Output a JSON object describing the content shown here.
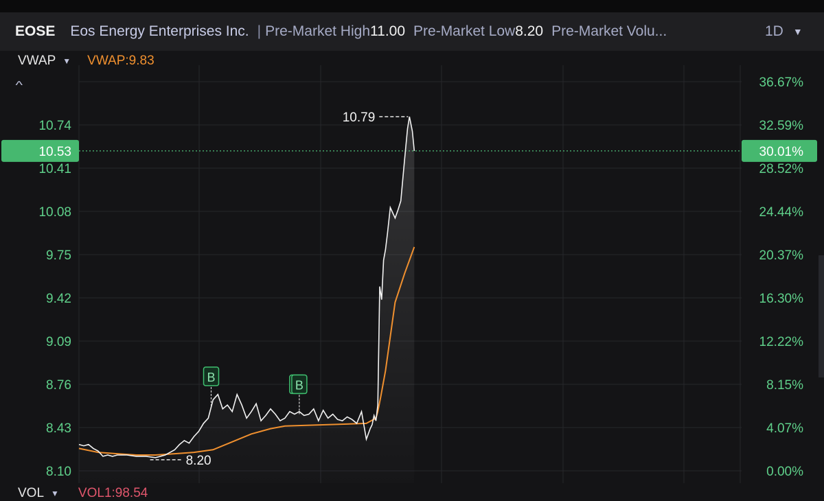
{
  "header": {
    "symbol": "EOSE",
    "company": "Eos Energy Enterprises Inc.",
    "separator": "|",
    "premarket_high_label": "Pre-Market High",
    "premarket_high_value": "11.00",
    "premarket_low_label": "Pre-Market Low",
    "premarket_low_value": "8.20",
    "premarket_volume_label": "Pre-Market Volu...",
    "timeframe": "1D"
  },
  "indicator": {
    "name": "VWAP",
    "value_label": "VWAP:9.83"
  },
  "volume": {
    "name": "VOL",
    "value_label": "VOL1:98.54"
  },
  "colors": {
    "background": "#141416",
    "price_line": "#f2f2f2",
    "vwap_line": "#f0902f",
    "up_green": "#5fd08a",
    "badge_green": "#3fbf6f",
    "grid": "#26272b"
  },
  "chart_data": {
    "type": "line",
    "price_ticks": [
      "8.10",
      "8.43",
      "8.76",
      "9.09",
      "9.42",
      "9.75",
      "10.08",
      "10.41",
      "10.74"
    ],
    "percent_ticks": [
      "0.00%",
      "4.07%",
      "8.15%",
      "12.22%",
      "16.30%",
      "20.37%",
      "24.44%",
      "28.52%",
      "32.59%",
      "36.67%"
    ],
    "ylim": [
      8.1,
      10.97
    ],
    "current_price": "10.53",
    "current_percent": "30.01%",
    "high_label": "10.79",
    "low_label": "8.20",
    "trade_markers": [
      {
        "label": "B",
        "x": 138,
        "y": 8.58
      },
      {
        "label": "B",
        "x": 230,
        "y": 8.52
      }
    ],
    "series": [
      {
        "name": "VWAP",
        "x": [
          0,
          20,
          40,
          60,
          80,
          100,
          120,
          140,
          160,
          180,
          200,
          215,
          300,
          310,
          312,
          315,
          320,
          325,
          330,
          340,
          350
        ],
        "values": [
          8.27,
          8.24,
          8.23,
          8.22,
          8.22,
          8.23,
          8.24,
          8.26,
          8.32,
          8.38,
          8.42,
          8.44,
          8.46,
          8.5,
          8.55,
          8.66,
          8.86,
          9.12,
          9.38,
          9.6,
          9.8
        ]
      },
      {
        "x": [
          0,
          5,
          10,
          15,
          20,
          25,
          30,
          35,
          40,
          50,
          60,
          70,
          80,
          90,
          100,
          105,
          110,
          115,
          120,
          125,
          130,
          135,
          140,
          145,
          150,
          155,
          160,
          165,
          170,
          175,
          180,
          185,
          190,
          195,
          200,
          205,
          210,
          215,
          220,
          225,
          230,
          235,
          240,
          245,
          250,
          255,
          260,
          265,
          270,
          275,
          280,
          285,
          290,
          295,
          300,
          304,
          306,
          308,
          310,
          312,
          314,
          316,
          318,
          320,
          322,
          325,
          330,
          333,
          336,
          340,
          343,
          345,
          348,
          350
        ],
        "values": [
          8.3,
          8.29,
          8.3,
          8.27,
          8.25,
          8.21,
          8.22,
          8.21,
          8.22,
          8.22,
          8.21,
          8.21,
          8.2,
          8.22,
          8.26,
          8.3,
          8.33,
          8.31,
          8.36,
          8.4,
          8.46,
          8.5,
          8.64,
          8.68,
          8.57,
          8.6,
          8.55,
          8.68,
          8.6,
          8.5,
          8.55,
          8.61,
          8.48,
          8.52,
          8.57,
          8.53,
          8.48,
          8.5,
          8.55,
          8.53,
          8.55,
          8.52,
          8.53,
          8.57,
          8.48,
          8.56,
          8.5,
          8.53,
          8.49,
          8.48,
          8.51,
          8.49,
          8.46,
          8.55,
          8.34,
          8.42,
          8.45,
          8.52,
          8.48,
          8.6,
          9.5,
          9.4,
          9.7,
          9.78,
          9.9,
          10.1,
          10.02,
          10.08,
          10.15,
          10.47,
          10.7,
          10.79,
          10.68,
          10.53
        ]
      }
    ]
  }
}
